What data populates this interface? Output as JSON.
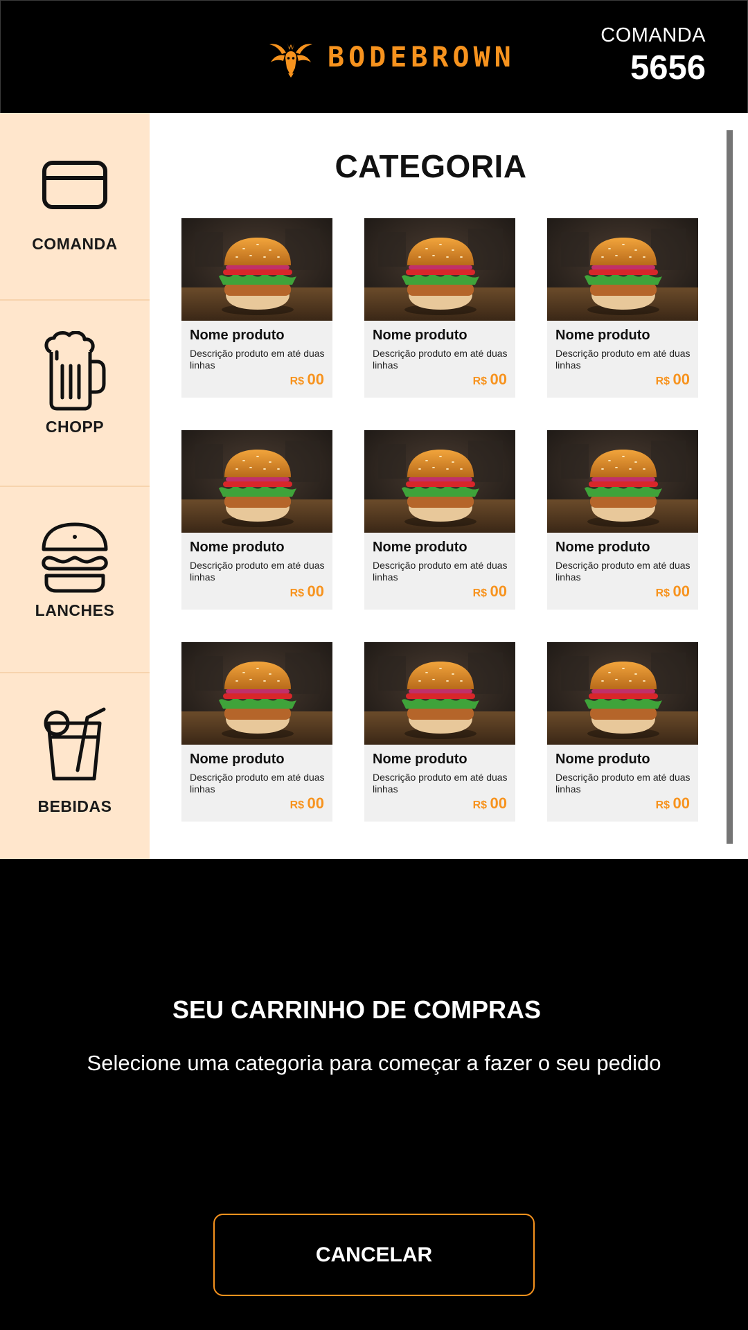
{
  "header": {
    "brand": "BODEBROWN",
    "comanda_label": "COMANDA",
    "comanda_number": "5656",
    "brand_color": "#f7931e"
  },
  "sidebar": {
    "items": [
      {
        "label": "COMANDA",
        "icon": "card-icon"
      },
      {
        "label": "CHOPP",
        "icon": "beer-mug-icon"
      },
      {
        "label": "LANCHES",
        "icon": "burger-icon"
      },
      {
        "label": "BEBIDAS",
        "icon": "drink-glass-icon"
      }
    ]
  },
  "main": {
    "title": "CATEGORIA",
    "products": [
      {
        "name": "Nome produto",
        "description": "Descrição produto em até duas linhas",
        "currency": "R$",
        "price": "00"
      },
      {
        "name": "Nome produto",
        "description": "Descrição produto em até duas linhas",
        "currency": "R$",
        "price": "00"
      },
      {
        "name": "Nome produto",
        "description": "Descrição produto em até duas linhas",
        "currency": "R$",
        "price": "00"
      },
      {
        "name": "Nome produto",
        "description": "Descrição produto em até duas linhas",
        "currency": "R$",
        "price": "00"
      },
      {
        "name": "Nome produto",
        "description": "Descrição produto em até duas linhas",
        "currency": "R$",
        "price": "00"
      },
      {
        "name": "Nome produto",
        "description": "Descrição produto em até duas linhas",
        "currency": "R$",
        "price": "00"
      },
      {
        "name": "Nome produto",
        "description": "Descrição produto em até duas linhas",
        "currency": "R$",
        "price": "00"
      },
      {
        "name": "Nome produto",
        "description": "Descrição produto em até duas linhas",
        "currency": "R$",
        "price": "00"
      },
      {
        "name": "Nome produto",
        "description": "Descrição produto em até duas linhas",
        "currency": "R$",
        "price": "00"
      }
    ]
  },
  "cart": {
    "title": "SEU CARRINHO DE COMPRAS",
    "subtitle": "Selecione uma categoria para começar a fazer o seu pedido",
    "cancel_label": "CANCELAR"
  },
  "colors": {
    "accent": "#f7931e",
    "sidebar_bg": "#ffe6cc",
    "card_bg": "#f0f0f0"
  }
}
